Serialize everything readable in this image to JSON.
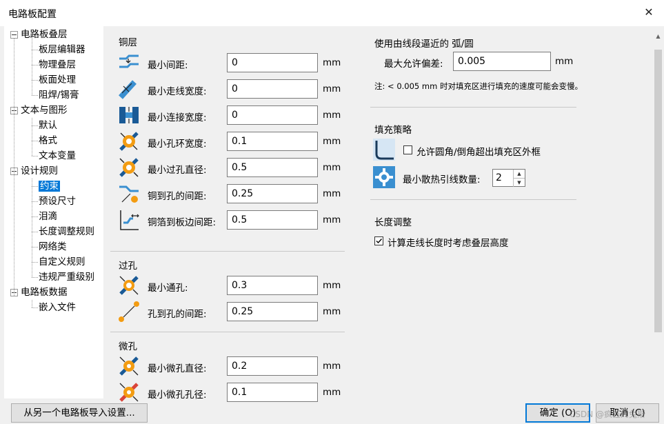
{
  "window": {
    "title": "电路板配置"
  },
  "tree": {
    "items": [
      {
        "label": "电路板叠层",
        "level": 0,
        "expanded": true
      },
      {
        "label": "板层编辑器",
        "level": 1
      },
      {
        "label": "物理叠层",
        "level": 1
      },
      {
        "label": "板面处理",
        "level": 1
      },
      {
        "label": "阻焊/锡膏",
        "level": 1
      },
      {
        "label": "文本与图形",
        "level": 0,
        "expanded": true
      },
      {
        "label": "默认",
        "level": 1
      },
      {
        "label": "格式",
        "level": 1
      },
      {
        "label": "文本变量",
        "level": 1
      },
      {
        "label": "设计规则",
        "level": 0,
        "expanded": true
      },
      {
        "label": "约束",
        "level": 1,
        "selected": true
      },
      {
        "label": "预设尺寸",
        "level": 1
      },
      {
        "label": "泪滴",
        "level": 1
      },
      {
        "label": "长度调整规则",
        "level": 1
      },
      {
        "label": "网络类",
        "level": 1
      },
      {
        "label": "自定义规则",
        "level": 1
      },
      {
        "label": "违规严重级别",
        "level": 1
      },
      {
        "label": "电路板数据",
        "level": 0,
        "expanded": true
      },
      {
        "label": "嵌入文件",
        "level": 1
      }
    ]
  },
  "copper": {
    "title": "铜层",
    "rows": [
      {
        "label": "最小间距:",
        "value": "0",
        "unit": "mm",
        "icon": "clearance-icon"
      },
      {
        "label": "最小走线宽度:",
        "value": "0",
        "unit": "mm",
        "icon": "track-width-icon"
      },
      {
        "label": "最小连接宽度:",
        "value": "0",
        "unit": "mm",
        "icon": "connection-width-icon"
      },
      {
        "label": "最小孔环宽度:",
        "value": "0.1",
        "unit": "mm",
        "icon": "annular-ring-icon"
      },
      {
        "label": "最小过孔直径:",
        "value": "0.5",
        "unit": "mm",
        "icon": "via-diameter-icon"
      },
      {
        "label": "铜到孔的间距:",
        "value": "0.25",
        "unit": "mm",
        "icon": "copper-hole-clearance-icon"
      },
      {
        "label": "铜箔到板边间距:",
        "value": "0.5",
        "unit": "mm",
        "icon": "edge-clearance-icon"
      }
    ]
  },
  "vias": {
    "title": "过孔",
    "rows": [
      {
        "label": "最小通孔:",
        "value": "0.3",
        "unit": "mm",
        "icon": "through-hole-icon"
      },
      {
        "label": "孔到孔的间距:",
        "value": "0.25",
        "unit": "mm",
        "icon": "hole-to-hole-icon"
      }
    ]
  },
  "microvias": {
    "title": "微孔",
    "rows": [
      {
        "label": "最小微孔直径:",
        "value": "0.2",
        "unit": "mm",
        "icon": "microvia-diameter-icon"
      },
      {
        "label": "最小微孔孔径:",
        "value": "0.1",
        "unit": "mm",
        "icon": "microvia-hole-icon"
      }
    ]
  },
  "arc": {
    "title": "使用由线段逼近的 弧/圆",
    "max_dev_label": "最大允许偏差:",
    "max_dev_value": "0.005",
    "unit": "mm",
    "note": "注: < 0.005 mm 时对填充区进行填充的速度可能会变慢。"
  },
  "fill": {
    "title": "填充策略",
    "allow_fillet_label": "允许圆角/倒角超出填充区外框",
    "allow_fillet_checked": false,
    "thermal_spokes_label": "最小散热引线数量:",
    "thermal_spokes_value": "2"
  },
  "length": {
    "title": "长度调整",
    "include_stackup_label": "计算走线长度时考虑叠层高度",
    "include_stackup_checked": true
  },
  "buttons": {
    "import": "从另一个电路板导入设置...",
    "ok": "确定 (O)",
    "cancel": "取消 (C)"
  },
  "watermark": "CSDN @疯狂的兔斯"
}
